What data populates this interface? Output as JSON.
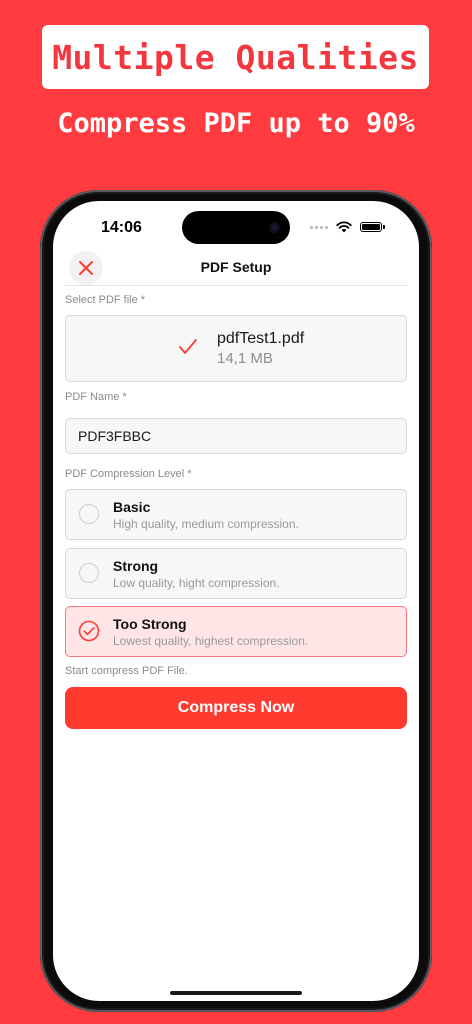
{
  "promo": {
    "headline": "Multiple Qualities",
    "subheadline": "Compress PDF up to 90%"
  },
  "status_bar": {
    "time": "14:06",
    "icons": [
      "signal-dots-icon",
      "wifi-icon",
      "battery-icon"
    ]
  },
  "nav": {
    "title": "PDF Setup",
    "close_icon": "close-icon"
  },
  "select_file": {
    "label": "Select PDF file *",
    "file_name": "pdfTest1.pdf",
    "file_size": "14,1 MB",
    "icon": "checkmark-icon"
  },
  "pdf_name": {
    "label": "PDF Name *",
    "value": "PDF3FBBC",
    "placeholder": ""
  },
  "compression": {
    "label": "PDF Compression Level *",
    "options": [
      {
        "title": "Basic",
        "description": "High quality, medium compression.",
        "selected": false
      },
      {
        "title": "Strong",
        "description": "Low quality, hight compression.",
        "selected": false
      },
      {
        "title": "Too Strong",
        "description": "Lowest quality, highest compression.",
        "selected": true
      }
    ]
  },
  "action": {
    "hint": "Start compress PDF File.",
    "button_label": "Compress Now"
  },
  "colors": {
    "background": "#FF3B3F",
    "accent": "#FF3B30",
    "selected_bg": "#FFE5E6",
    "selected_border": "#F47A7D"
  }
}
